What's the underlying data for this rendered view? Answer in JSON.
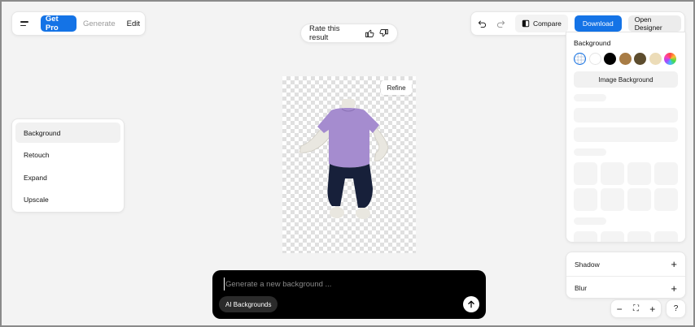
{
  "topbar": {
    "menu_icon": "hamburger-menu-icon",
    "get_pro_label": "Get Pro",
    "generate_label": "Generate",
    "edit_label": "Edit"
  },
  "rating": {
    "text": "Rate this result",
    "like_icon": "thumbs-up-icon",
    "dislike_icon": "thumbs-down-icon"
  },
  "toolbar": {
    "undo_icon": "undo-icon",
    "redo_icon": "redo-icon",
    "compare_label": "Compare",
    "download_label": "Download",
    "open_designer_label": "Open Designer"
  },
  "left_menu": {
    "items": [
      {
        "label": "Background",
        "active": true
      },
      {
        "label": "Retouch",
        "active": false
      },
      {
        "label": "Expand",
        "active": false
      },
      {
        "label": "Upscale",
        "active": false
      }
    ]
  },
  "canvas": {
    "refine_label": "Refine"
  },
  "background_panel": {
    "title": "Background",
    "swatches": [
      {
        "name": "transparent",
        "color": "transparent",
        "selected": true
      },
      {
        "name": "white",
        "color": "#ffffff",
        "selected": false
      },
      {
        "name": "black",
        "color": "#000000",
        "selected": false
      },
      {
        "name": "tan",
        "color": "#a87c45",
        "selected": false
      },
      {
        "name": "olive-brown",
        "color": "#5d4d2e",
        "selected": false
      },
      {
        "name": "cream",
        "color": "#ecdcb8",
        "selected": false
      },
      {
        "name": "gradient",
        "color": "rainbow",
        "selected": false
      }
    ],
    "image_background_label": "Image Background"
  },
  "adjust_panel": {
    "shadow_label": "Shadow",
    "blur_label": "Blur"
  },
  "zoom": {
    "zoom_out": "−",
    "fit": "⛶",
    "zoom_in": "+",
    "help": "?"
  },
  "prompt": {
    "placeholder": "Generate a new background ...",
    "value": "",
    "ai_backgrounds_label": "AI Backgrounds"
  },
  "colors": {
    "accent": "#1473e6",
    "prompt_bg": "#000000"
  }
}
